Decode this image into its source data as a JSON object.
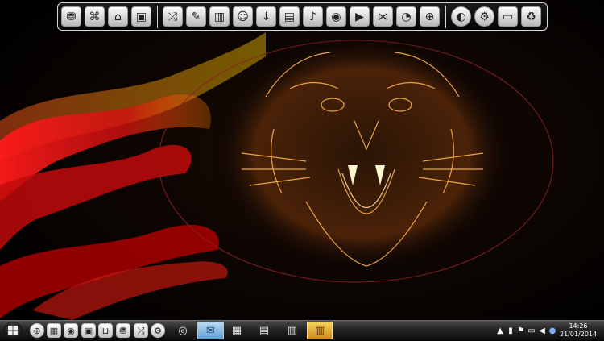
{
  "top_dock": {
    "group1": [
      {
        "icon": "network-drive-icon",
        "glyph": "⛃"
      },
      {
        "icon": "network-map-icon",
        "glyph": "⌘"
      },
      {
        "icon": "control-panel-icon",
        "glyph": "⌂"
      },
      {
        "icon": "display-settings-icon",
        "glyph": "▣"
      }
    ],
    "group2": [
      {
        "icon": "shuffle-icon",
        "glyph": "⤮"
      },
      {
        "icon": "paint-icon",
        "glyph": "✎"
      },
      {
        "icon": "library-icon",
        "glyph": "▥"
      },
      {
        "icon": "user-icon",
        "glyph": "☺"
      },
      {
        "icon": "download-icon",
        "glyph": "↓"
      },
      {
        "icon": "document-icon",
        "glyph": "▤"
      },
      {
        "icon": "music-icon",
        "glyph": "♪"
      },
      {
        "icon": "camera-icon",
        "glyph": "◉"
      },
      {
        "icon": "video-camera-icon",
        "glyph": "▶"
      },
      {
        "icon": "media-player-icon",
        "glyph": "⋈"
      },
      {
        "icon": "recording-icon",
        "glyph": "◔"
      },
      {
        "icon": "internet-globe-icon",
        "glyph": "⊕"
      }
    ],
    "group3": [
      {
        "icon": "compass-icon",
        "glyph": "◐"
      },
      {
        "icon": "settings-gear-icon",
        "glyph": "⚙"
      },
      {
        "icon": "monitor-icon",
        "glyph": "▭"
      },
      {
        "icon": "recycle-bin-icon",
        "glyph": "♻"
      }
    ]
  },
  "taskbar": {
    "start_icon": "windows-logo-icon",
    "quick_launch": [
      {
        "icon": "internet-globe-icon",
        "glyph": "⊕"
      },
      {
        "icon": "apps-grid-icon",
        "glyph": "▦"
      },
      {
        "icon": "camera-icon",
        "glyph": "◉"
      },
      {
        "icon": "display-icon",
        "glyph": "▣"
      },
      {
        "icon": "shopping-basket-icon",
        "glyph": "⊔"
      },
      {
        "icon": "network-drive-icon",
        "glyph": "⛃"
      },
      {
        "icon": "shuffle-icon",
        "glyph": "⤮"
      },
      {
        "icon": "settings-gear-icon",
        "glyph": "⚙"
      }
    ],
    "running_apps": [
      {
        "icon": "chrome-icon",
        "glyph": "◎",
        "active": false
      },
      {
        "icon": "mail-icon",
        "glyph": "✉",
        "active": true
      },
      {
        "icon": "calculator-icon",
        "glyph": "▦",
        "active": false
      },
      {
        "icon": "sticky-notes-icon",
        "glyph": "▤",
        "active": false
      },
      {
        "icon": "window-app-icon",
        "glyph": "▥",
        "active": false
      },
      {
        "icon": "library-books-icon",
        "glyph": "▥",
        "active": false
      }
    ],
    "tray": [
      {
        "icon": "show-hidden-icons-arrow",
        "glyph": "▲"
      },
      {
        "icon": "usb-device-icon",
        "glyph": "▮"
      },
      {
        "icon": "action-center-flag-icon",
        "glyph": "⚑"
      },
      {
        "icon": "network-icon",
        "glyph": "▭"
      },
      {
        "icon": "volume-icon",
        "glyph": "◀"
      },
      {
        "icon": "language-icon",
        "glyph": "●"
      }
    ],
    "clock": {
      "time": "14:26",
      "date": "21/01/2014"
    }
  }
}
